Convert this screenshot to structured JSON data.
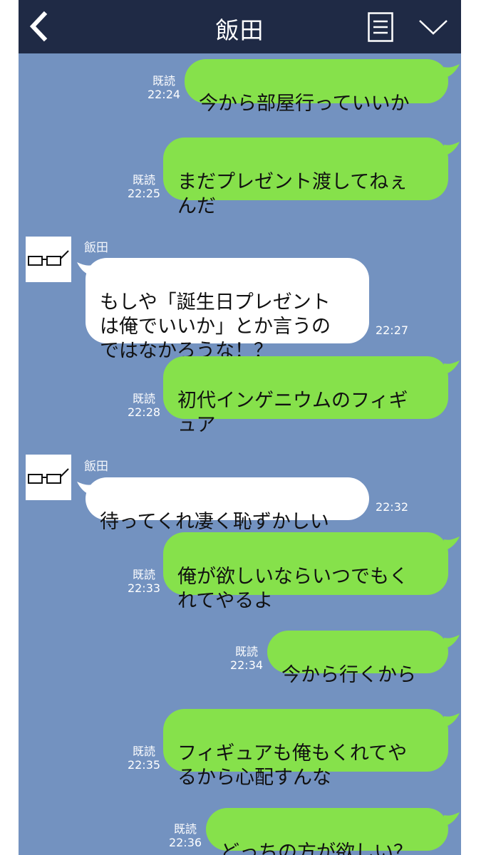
{
  "header": {
    "title": "飯田"
  },
  "icons": {
    "back": "chevron-left-icon",
    "menu": "menu-list-icon",
    "collapse": "chevron-down-icon",
    "avatar": "glasses-icon"
  },
  "colors": {
    "background": "#7392c0",
    "header": "#1f2a45",
    "outgoing_bubble": "#86e14b",
    "incoming_bubble": "#ffffff"
  },
  "messages": [
    {
      "direction": "out",
      "text": "今から部屋行っていいか",
      "read": "既読",
      "time": "22:24"
    },
    {
      "direction": "out",
      "text": "まだプレゼント渡してねぇ\nんだ",
      "read": "既読",
      "time": "22:25"
    },
    {
      "direction": "in",
      "sender": "飯田",
      "text": "もしや「誕生日プレゼント\nは俺でいいか」とか言うの\nではなかろうな！？",
      "time": "22:27"
    },
    {
      "direction": "out",
      "text": "初代インゲニウムのフィギ\nュア",
      "read": "既読",
      "time": "22:28"
    },
    {
      "direction": "in",
      "sender": "飯田",
      "text": "待ってくれ凄く恥ずかしい",
      "time": "22:32"
    },
    {
      "direction": "out",
      "text": "俺が欲しいならいつでもく\nれてやるよ",
      "read": "既読",
      "time": "22:33"
    },
    {
      "direction": "out",
      "text": "今から行くから",
      "read": "既読",
      "time": "22:34"
    },
    {
      "direction": "out",
      "text": "フィギュアも俺もくれてや\nるから心配すんな",
      "read": "既読",
      "time": "22:35"
    },
    {
      "direction": "out",
      "text": "どっちの方が欲しい？",
      "read": "既読",
      "time": "22:36"
    }
  ]
}
